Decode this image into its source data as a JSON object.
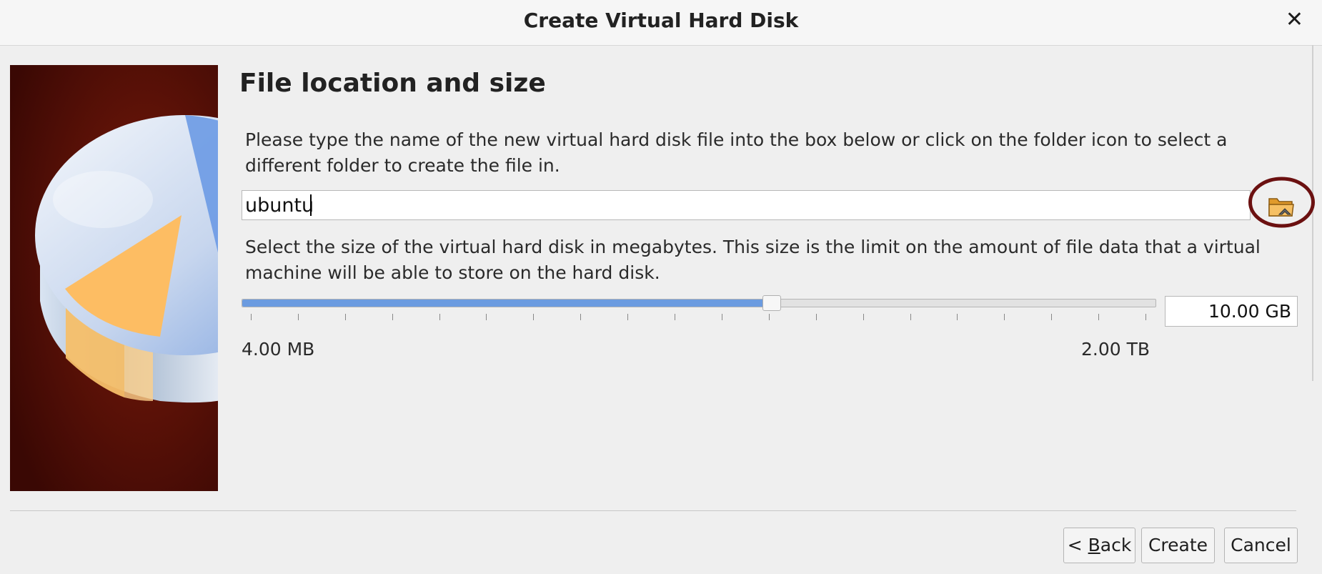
{
  "window": {
    "title": "Create Virtual Hard Disk",
    "close_label": "✕"
  },
  "page": {
    "heading": "File location and size",
    "location_description": "Please type the name of the new virtual hard disk file into the box below or click on the folder icon to select a different folder to create the file in.",
    "file_name": "ubuntu",
    "folder_button_icon": "folder-icon",
    "size_description": "Select the size of the virtual hard disk in megabytes. This size is the limit on the amount of file data that a virtual machine will be able to store on the hard disk.",
    "size_value": "10.00 GB",
    "slider_fraction": 0.58,
    "tick_count": 20,
    "min_size_label": "4.00 MB",
    "max_size_label": "2.00 TB"
  },
  "buttons": {
    "back_prefix": "< ",
    "back_mnemonic": "B",
    "back_rest": "ack",
    "create": "Create",
    "cancel": "Cancel"
  },
  "colors": {
    "slider_fill": "#6b9be0",
    "highlight_ring": "#6b1010",
    "side_panel_bg": "#5a1208"
  }
}
